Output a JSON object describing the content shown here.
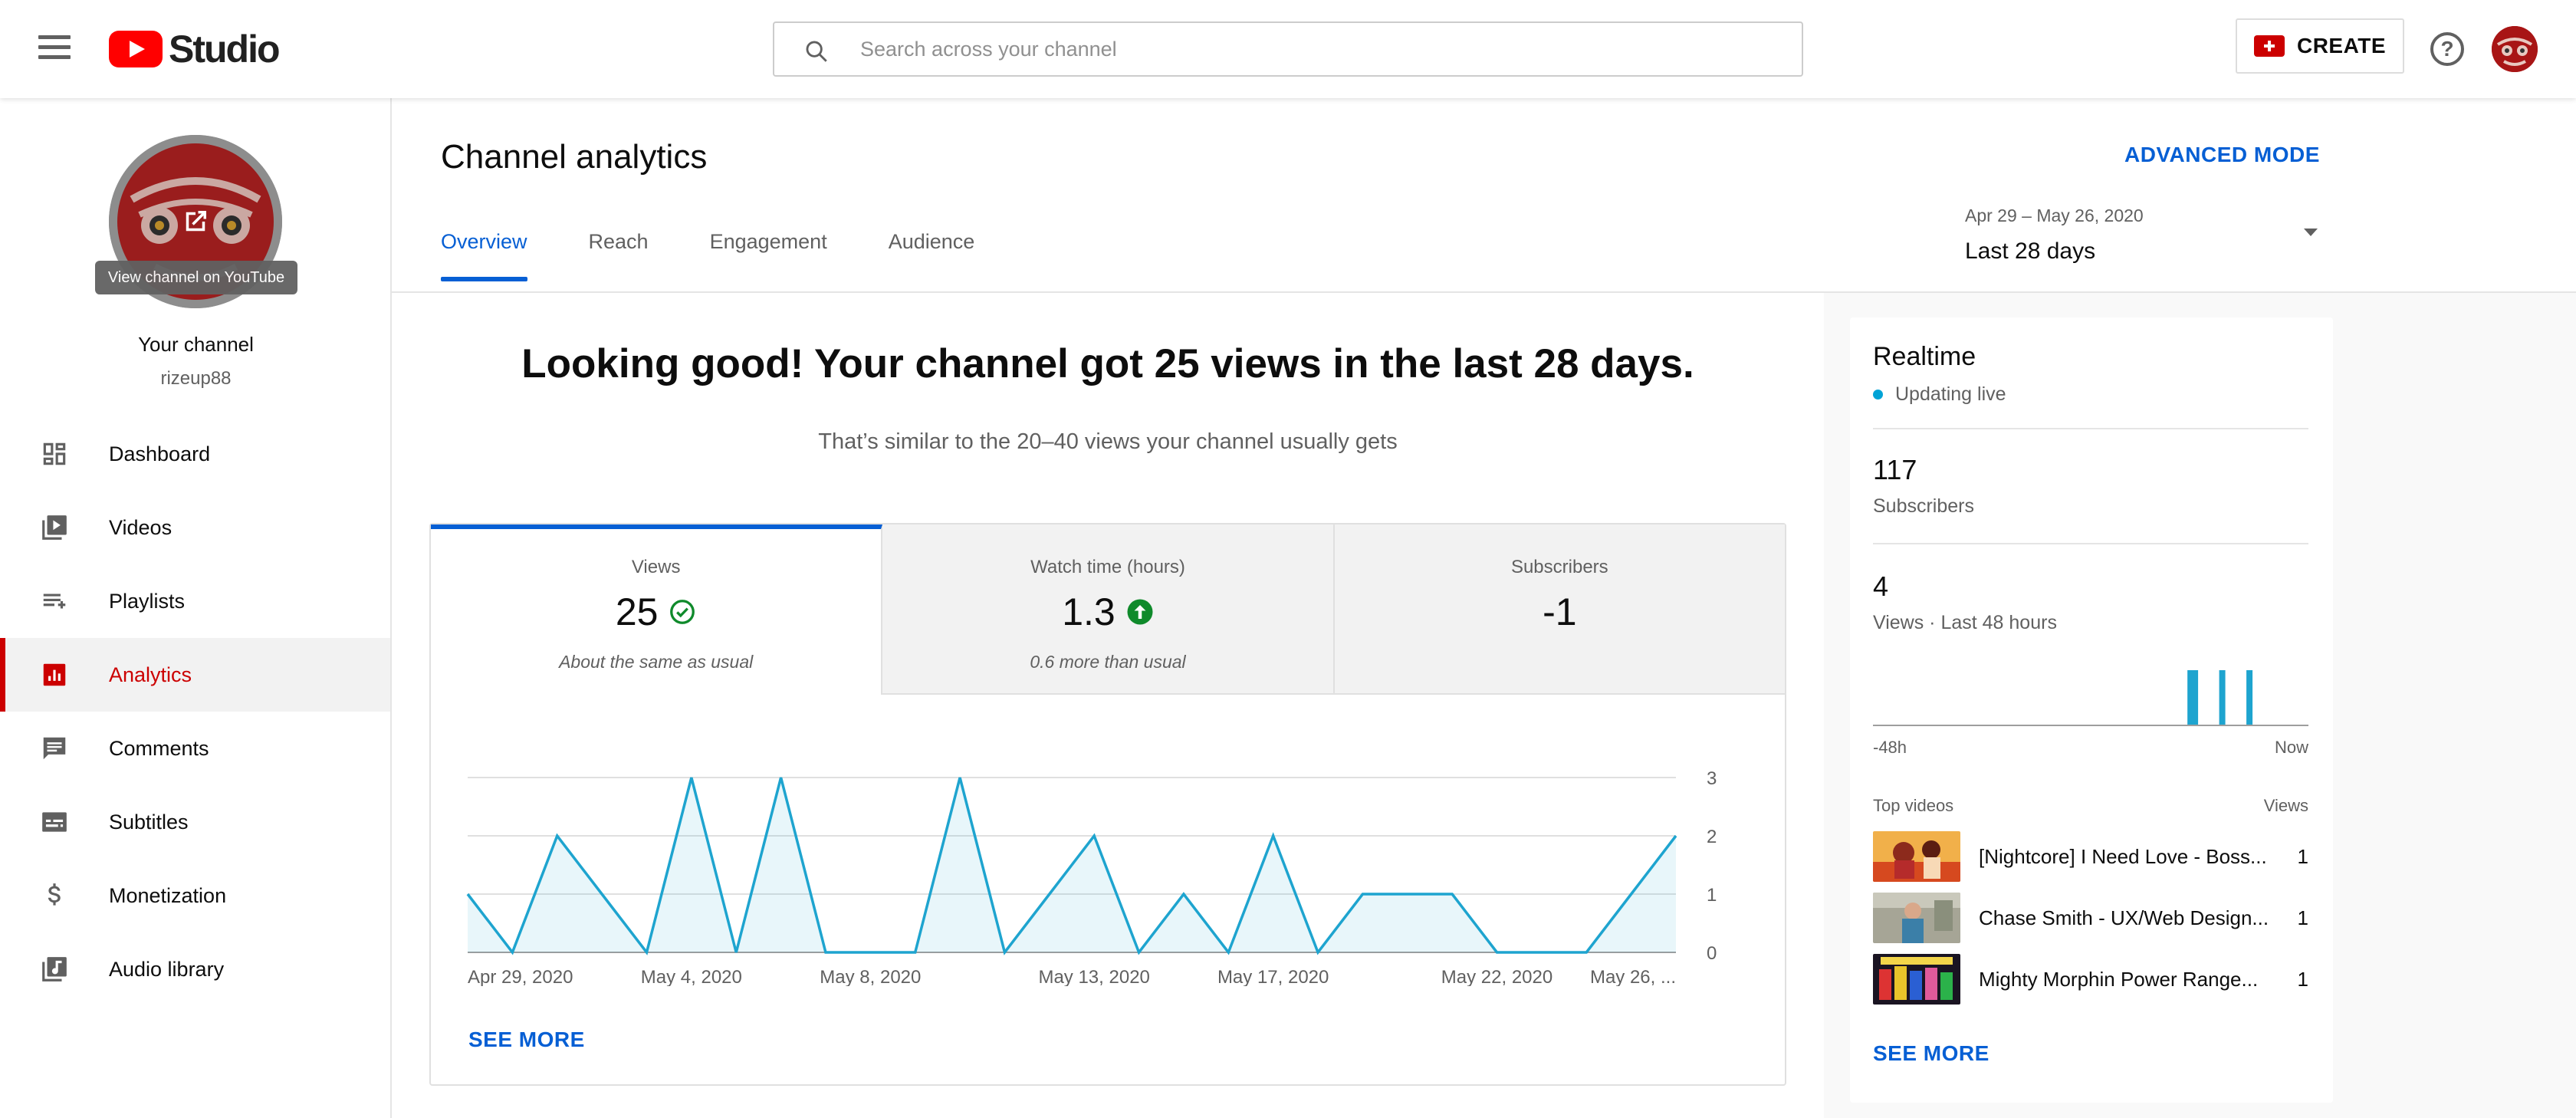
{
  "header": {
    "logo_text": "Studio",
    "search_placeholder": "Search across your channel",
    "create_label": "CREATE",
    "help_label": "?"
  },
  "sidebar": {
    "view_channel_tooltip": "View channel on YouTube",
    "channel_title": "Your channel",
    "channel_handle": "rizeup88",
    "items": [
      {
        "label": "Dashboard",
        "icon": "dashboard-icon",
        "active": false
      },
      {
        "label": "Videos",
        "icon": "videos-icon",
        "active": false
      },
      {
        "label": "Playlists",
        "icon": "playlists-icon",
        "active": false
      },
      {
        "label": "Analytics",
        "icon": "analytics-icon",
        "active": true
      },
      {
        "label": "Comments",
        "icon": "comments-icon",
        "active": false
      },
      {
        "label": "Subtitles",
        "icon": "subtitles-icon",
        "active": false
      },
      {
        "label": "Monetization",
        "icon": "dollar-icon",
        "active": false
      },
      {
        "label": "Audio library",
        "icon": "audio-library-icon",
        "active": false
      }
    ]
  },
  "page": {
    "title": "Channel analytics",
    "advanced_mode": "ADVANCED MODE",
    "tabs": [
      "Overview",
      "Reach",
      "Engagement",
      "Audience"
    ],
    "date_range": "Apr 29 – May 26, 2020",
    "date_label": "Last 28 days"
  },
  "overview": {
    "headline": "Looking good! Your channel got 25 views in the last 28 days.",
    "subline": "That’s similar to the 20–40 views your channel usually gets",
    "metrics": [
      {
        "title": "Views",
        "value": "25",
        "note": "About the same as usual",
        "status": "check"
      },
      {
        "title": "Watch time (hours)",
        "value": "1.3",
        "note": "0.6 more than usual",
        "status": "up"
      },
      {
        "title": "Subscribers",
        "value": "-1",
        "note": "",
        "status": "none"
      }
    ],
    "see_more": "SEE MORE"
  },
  "chart_data": {
    "type": "area",
    "x": [
      "Apr 29",
      "Apr 30",
      "May 1",
      "May 2",
      "May 3",
      "May 4",
      "May 5",
      "May 6",
      "May 7",
      "May 8",
      "May 9",
      "May 10",
      "May 11",
      "May 12",
      "May 13",
      "May 14",
      "May 15",
      "May 16",
      "May 17",
      "May 18",
      "May 19",
      "May 20",
      "May 21",
      "May 22",
      "May 23",
      "May 24",
      "May 25",
      "May 26"
    ],
    "series": [
      {
        "values": [
          1,
          0,
          2,
          1,
          0,
          3,
          0,
          3,
          0,
          0,
          0,
          3,
          0,
          1,
          2,
          0,
          1,
          0,
          2,
          0,
          1,
          1,
          1,
          0,
          0,
          0,
          1,
          2
        ]
      }
    ],
    "x_tick_labels": [
      "Apr 29, 2020",
      "May 4, 2020",
      "May 8, 2020",
      "May 13, 2020",
      "May 17, 2020",
      "May 22, 2020",
      "May 26, ..."
    ],
    "x_tick_index": [
      0,
      5,
      9,
      14,
      18,
      23,
      27
    ],
    "y_ticks": [
      0,
      1,
      2,
      3
    ],
    "ylim": [
      0,
      3
    ],
    "y_axis_side": "right",
    "grid": true,
    "color": "#1ea4cf"
  },
  "realtime": {
    "title": "Realtime",
    "live_label": "Updating live",
    "subscribers_value": "117",
    "subscribers_label": "Subscribers",
    "views_value": "4",
    "views_label": "Views · Last 48 hours",
    "axis_start": "-48h",
    "axis_end": "Now",
    "spark_hours_ago": [
      13,
      12.5,
      9.5,
      6.5
    ],
    "top_videos_label": "Top videos",
    "views_col_label": "Views",
    "videos": [
      {
        "title": "[Nightcore] I Need Love - Boss...",
        "views": "1"
      },
      {
        "title": "Chase Smith - UX/Web Design...",
        "views": "1"
      },
      {
        "title": "Mighty Morphin Power Range...",
        "views": "1"
      }
    ],
    "see_more": "SEE MORE"
  }
}
